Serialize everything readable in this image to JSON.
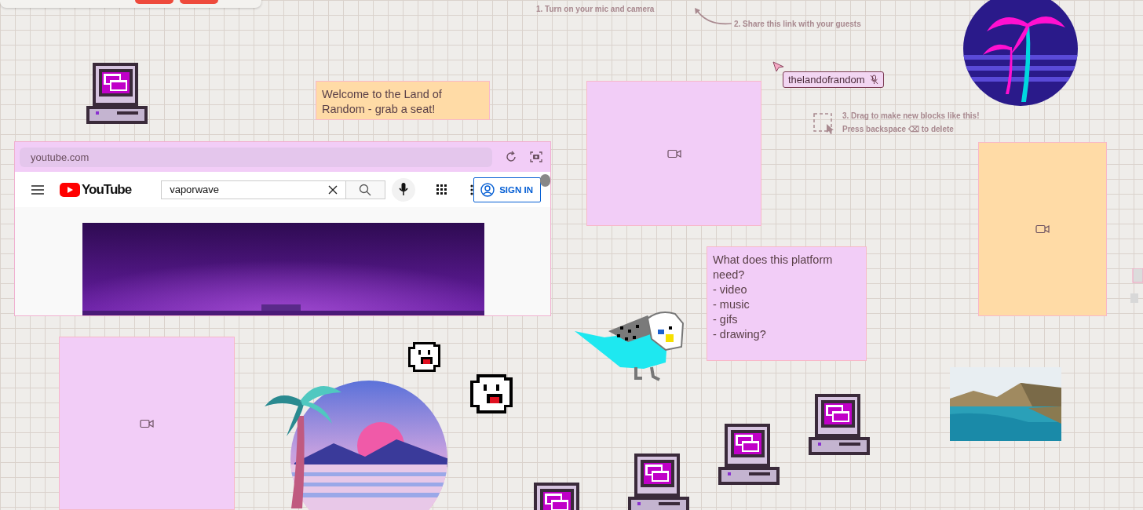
{
  "instructions": [
    {
      "text": "1. Turn on your mic and camera"
    },
    {
      "text": "2. Share this link with your guests"
    }
  ],
  "user_tag": {
    "name": "thelandofrandom"
  },
  "hint": {
    "line_1": "3. Drag to make new blocks like this!",
    "line_2": "Press backspace ⌫ to delete"
  },
  "notes": [
    {
      "text": "Welcome to the Land of\nRandom - grab a seat!",
      "color": "#ffdba6"
    },
    {
      "text": "What does this platform need?\n- video\n- music\n- gifs\n- drawing?",
      "color": "#f2cdf7"
    }
  ],
  "video_blocks": [
    {
      "color": "#f2cdf7"
    },
    {
      "color": "#ffdba6"
    },
    {
      "color": "#f2cdf7"
    }
  ],
  "embed": {
    "url": "youtube.com",
    "logo": "YouTube",
    "search_value": "vaporwave",
    "sign_in": "SIGN IN"
  }
}
